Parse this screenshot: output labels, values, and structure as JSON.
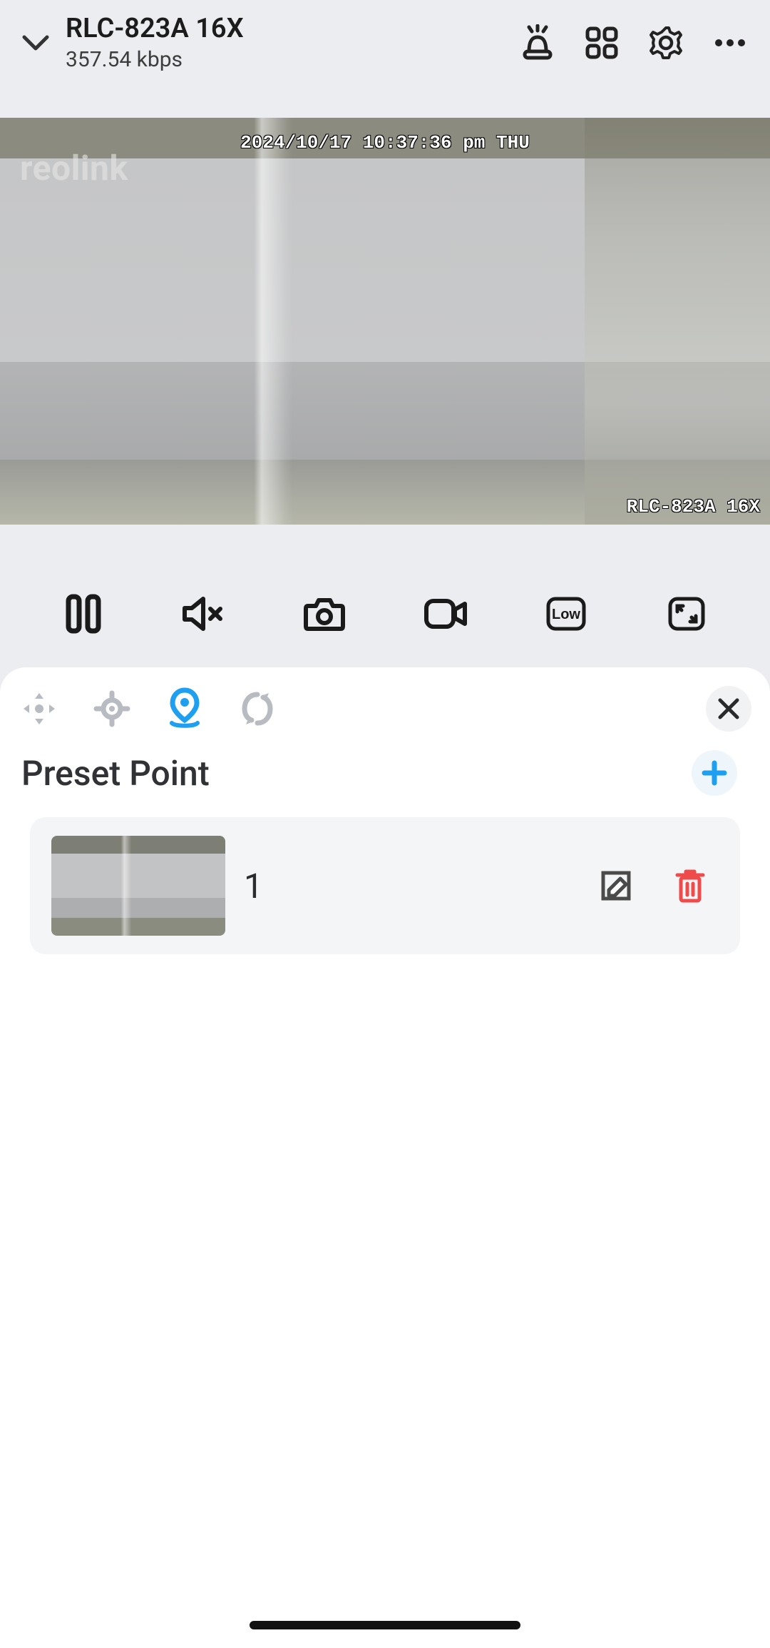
{
  "header": {
    "camera_title": "RLC-823A 16X",
    "bitrate": "357.54 kbps"
  },
  "video": {
    "brand": "reolink",
    "timestamp": "2024/10/17 10:37:36 pm THU",
    "camera_label": "RLC-823A 16X"
  },
  "controls": {
    "quality_label": "Low"
  },
  "ptz": {
    "section_title": "Preset Point",
    "presets": [
      {
        "name": "1"
      }
    ]
  }
}
